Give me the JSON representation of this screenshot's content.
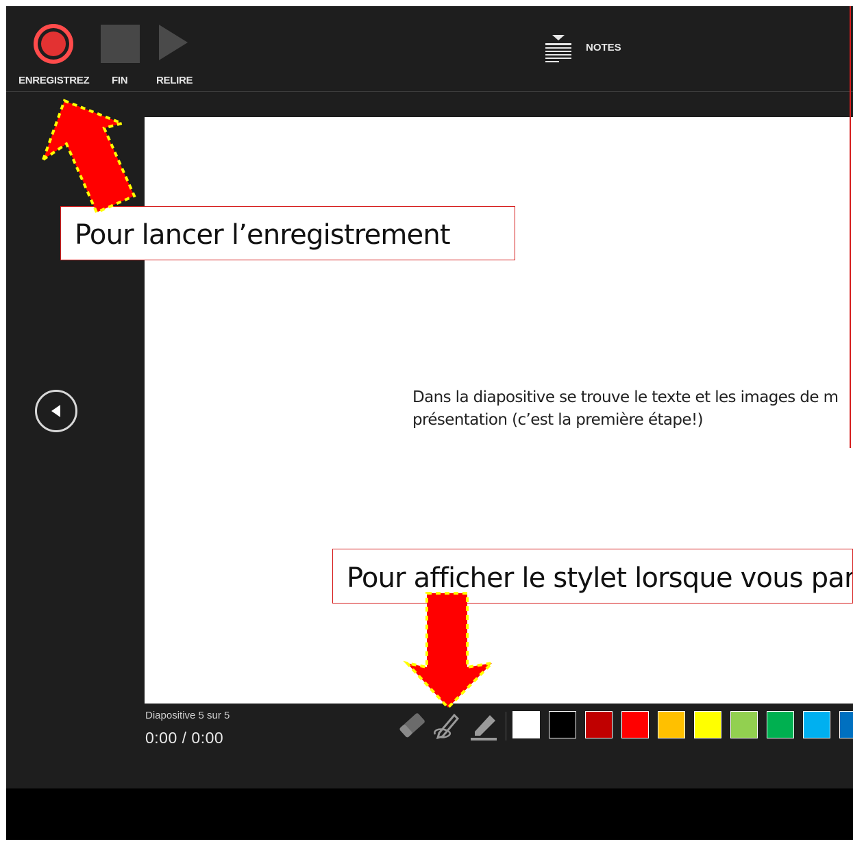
{
  "toolbar": {
    "record_label": "ENREGISTREZ",
    "stop_label": "FIN",
    "replay_label": "RELIRE",
    "notes_label": "NOTES"
  },
  "slide": {
    "line1": "Dans la diapositive se trouve le texte et les images de m",
    "line2": "présentation (c’est la première étape!)"
  },
  "callouts": {
    "record": "Pour lancer l’enregistrement",
    "stylus": "Pour afficher le stylet lorsque vous par"
  },
  "status": {
    "slide_counter": "Diapositive 5 sur 5",
    "time": "0:00 / 0:00"
  },
  "colors": {
    "swatches": [
      "#ffffff",
      "#000000",
      "#c00000",
      "#ff0000",
      "#ffc000",
      "#ffff00",
      "#92d050",
      "#00b050",
      "#00b0f0",
      "#0070c0"
    ],
    "arrow_fill": "#ff0000",
    "arrow_outline": "#ffff00",
    "callout_border": "#d61e1e"
  },
  "icons": [
    "record-icon",
    "stop-icon",
    "play-icon",
    "notes-icon",
    "previous-slide-icon",
    "eraser-icon",
    "pen-icon",
    "highlighter-icon"
  ]
}
